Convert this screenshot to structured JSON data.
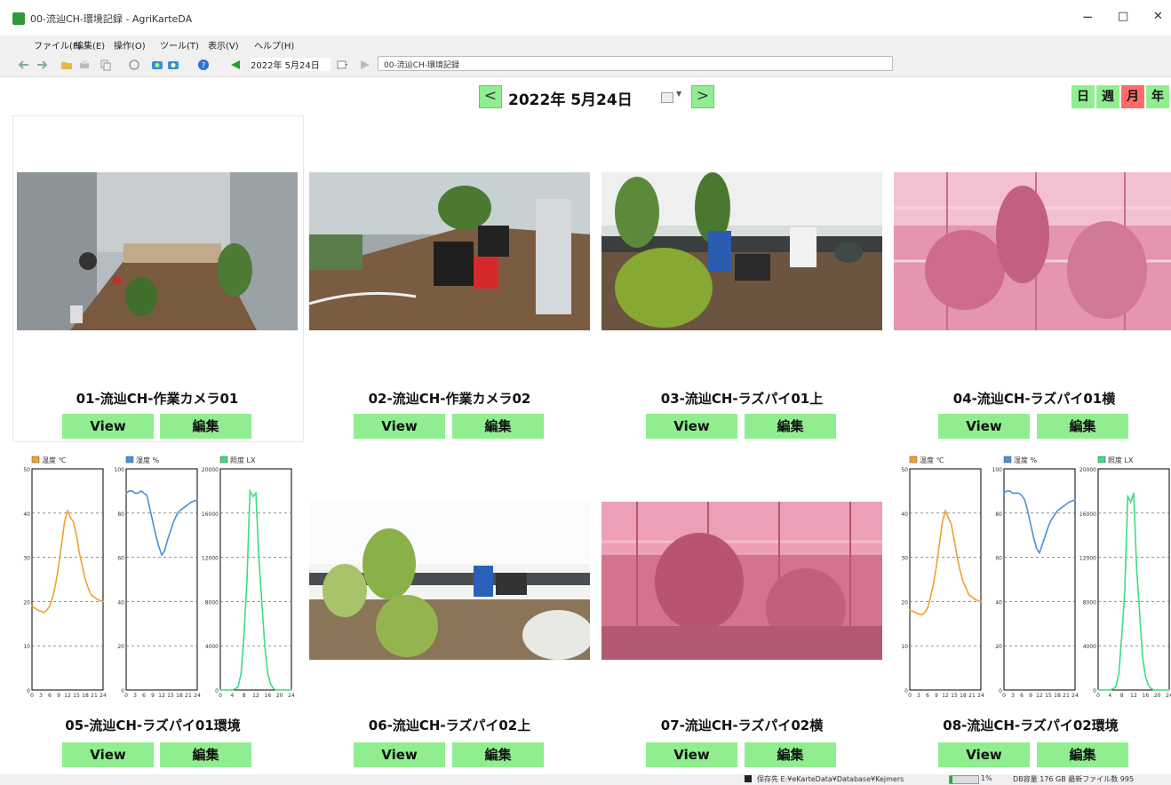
{
  "window": {
    "title": "00-流辿CH-環境記録 - AgriKarteDA",
    "min": "−",
    "max": "□",
    "close": "✕"
  },
  "menu": [
    "ファイル(F)",
    "編集(E)",
    "操作(O)",
    "ツール(T)",
    "表示(V)",
    "ヘルプ(H)"
  ],
  "toolbar": {
    "date": "2022年 5月24日",
    "path": "00-流辿CH-環境記録",
    "icons": [
      "back-icon",
      "forward-icon",
      "open-folder-icon",
      "print-icon",
      "copy-icon",
      "refresh-icon",
      "camera-icon",
      "camera2-icon",
      "help-icon",
      "prev-triangle-icon",
      "calendar-icon",
      "next-triangle-icon"
    ]
  },
  "datenav": {
    "prev": "<",
    "date": "2022年 5月24日",
    "next": ">"
  },
  "views": [
    {
      "label": "日",
      "color": "#90ee90"
    },
    {
      "label": "週",
      "color": "#90ee90"
    },
    {
      "label": "月",
      "color": "#ff6b6b"
    },
    {
      "label": "年",
      "color": "#90ee90"
    }
  ],
  "buttons": {
    "view": "View",
    "edit": "編集"
  },
  "cameras": [
    {
      "label": "01-流辿CH-作業カメラ01",
      "type": "photo",
      "scene": "greenhouse-work-camera-1"
    },
    {
      "label": "02-流辿CH-作業カメラ02",
      "type": "photo",
      "scene": "greenhouse-work-camera-2"
    },
    {
      "label": "03-流辿CH-ラズパイ01上",
      "type": "photo",
      "scene": "greenhouse-raspi-top"
    },
    {
      "label": "04-流辿CH-ラズパイ01横",
      "type": "photo",
      "scene": "greenhouse-raspi-side-pink"
    },
    {
      "label": "05-流辿CH-ラズパイ01環境",
      "type": "charts"
    },
    {
      "label": "06-流辿CH-ラズパイ02上",
      "type": "photo",
      "scene": "greenhouse-raspi2-top"
    },
    {
      "label": "07-流辿CH-ラズパイ02横",
      "type": "photo",
      "scene": "greenhouse-raspi2-side-pink"
    },
    {
      "label": "08-流辿CH-ラズパイ02環境",
      "type": "charts"
    }
  ],
  "chart_data": [
    {
      "type": "line",
      "title": "温度 ℃",
      "color": "#f0a030",
      "ylim": [
        0,
        50
      ],
      "yticks": [
        0,
        10,
        20,
        30,
        40,
        50
      ],
      "xticks": [
        "0",
        "3",
        "6",
        "9",
        "12",
        "15",
        "18",
        "21",
        "24"
      ],
      "x": [
        0,
        1,
        2,
        3,
        4,
        5,
        6,
        7,
        8,
        9,
        10,
        11,
        12,
        13,
        14,
        15,
        16,
        17,
        18,
        19,
        20,
        21,
        22,
        23,
        24
      ],
      "y": [
        19,
        18.5,
        18,
        17.8,
        17.5,
        18,
        19,
        21,
        24,
        28,
        33,
        38,
        40.5,
        39,
        38,
        35,
        31,
        28,
        25,
        23,
        21.5,
        21,
        20.5,
        20.2,
        20
      ]
    },
    {
      "type": "line",
      "title": "湿度 %",
      "color": "#4a90d9",
      "ylim": [
        0,
        100
      ],
      "yticks": [
        0,
        20,
        40,
        60,
        80,
        100
      ],
      "xticks": [
        "0",
        "3",
        "6",
        "9",
        "12",
        "15",
        "18",
        "21",
        "24"
      ],
      "x": [
        0,
        1,
        2,
        3,
        4,
        5,
        6,
        7,
        8,
        9,
        10,
        11,
        12,
        13,
        14,
        15,
        16,
        17,
        18,
        19,
        20,
        21,
        22,
        23,
        24
      ],
      "y": [
        89,
        90,
        90,
        89,
        89,
        90,
        89,
        88,
        82,
        76,
        70,
        65,
        61,
        63,
        68,
        72,
        76,
        79,
        81,
        82,
        83,
        84,
        85,
        85.5,
        86
      ]
    },
    {
      "type": "line",
      "title": "照度 LX",
      "color": "#3ddc84",
      "ylim": [
        0,
        20000
      ],
      "yticks": [
        0,
        4000,
        8000,
        12000,
        16000,
        20000
      ],
      "xticks": [
        "0",
        "4",
        "8",
        "12",
        "16",
        "20",
        "24"
      ],
      "x": [
        0,
        1,
        2,
        3,
        4,
        5,
        6,
        7,
        8,
        9,
        10,
        11,
        12,
        13,
        14,
        15,
        16,
        17,
        18,
        19,
        20,
        21,
        22,
        23,
        24
      ],
      "y": [
        0,
        0,
        0,
        0,
        0,
        100,
        300,
        1500,
        5000,
        10000,
        18000,
        17500,
        17800,
        12000,
        8000,
        4000,
        1500,
        500,
        100,
        0,
        0,
        0,
        0,
        0,
        0
      ]
    },
    {
      "type": "line",
      "title": "温度 ℃",
      "color": "#f0a030",
      "ylim": [
        0,
        50
      ],
      "yticks": [
        0,
        10,
        20,
        30,
        40,
        50
      ],
      "xticks": [
        "0",
        "3",
        "6",
        "9",
        "12",
        "15",
        "18",
        "21",
        "24"
      ],
      "x": [
        0,
        1,
        2,
        3,
        4,
        5,
        6,
        7,
        8,
        9,
        10,
        11,
        12,
        13,
        14,
        15,
        16,
        17,
        18,
        19,
        20,
        21,
        22,
        23,
        24
      ],
      "y": [
        18,
        17.8,
        17.5,
        17.2,
        17,
        17.5,
        18.5,
        21,
        24,
        28,
        33,
        38,
        40.5,
        39,
        37.5,
        34,
        30,
        27,
        24.5,
        23,
        21.5,
        21,
        20.5,
        20.2,
        20
      ]
    },
    {
      "type": "line",
      "title": "湿度 %",
      "color": "#4a90d9",
      "ylim": [
        0,
        100
      ],
      "yticks": [
        0,
        20,
        40,
        60,
        80,
        100
      ],
      "xticks": [
        "0",
        "3",
        "6",
        "9",
        "12",
        "15",
        "18",
        "21",
        "24"
      ],
      "x": [
        0,
        1,
        2,
        3,
        4,
        5,
        6,
        7,
        8,
        9,
        10,
        11,
        12,
        13,
        14,
        15,
        16,
        17,
        18,
        19,
        20,
        21,
        22,
        23,
        24
      ],
      "y": [
        89,
        90,
        90,
        89,
        89,
        89,
        88,
        86,
        81,
        75,
        69,
        64,
        62,
        66,
        70,
        74,
        77,
        79,
        81,
        82,
        83,
        84,
        85,
        85.5,
        86
      ]
    },
    {
      "type": "line",
      "title": "照度 LX",
      "color": "#3ddc84",
      "ylim": [
        0,
        20000
      ],
      "yticks": [
        0,
        4000,
        8000,
        12000,
        16000,
        20000
      ],
      "xticks": [
        "0",
        "4",
        "8",
        "12",
        "16",
        "20",
        "24"
      ],
      "x": [
        0,
        1,
        2,
        3,
        4,
        5,
        6,
        7,
        8,
        9,
        10,
        11,
        12,
        13,
        14,
        15,
        16,
        17,
        18,
        19,
        20,
        21,
        22,
        23,
        24
      ],
      "y": [
        0,
        0,
        0,
        0,
        0,
        100,
        300,
        1500,
        5000,
        9000,
        17500,
        17000,
        17800,
        11000,
        7000,
        3000,
        1200,
        400,
        100,
        0,
        0,
        0,
        0,
        0,
        0
      ]
    }
  ],
  "status": {
    "text": "保存先 E:¥eKarteData¥Database¥Kejmers",
    "progress": 0.1,
    "progress_label": "1%",
    "db": "DB容量 176 GB  最新ファイル数 995"
  }
}
